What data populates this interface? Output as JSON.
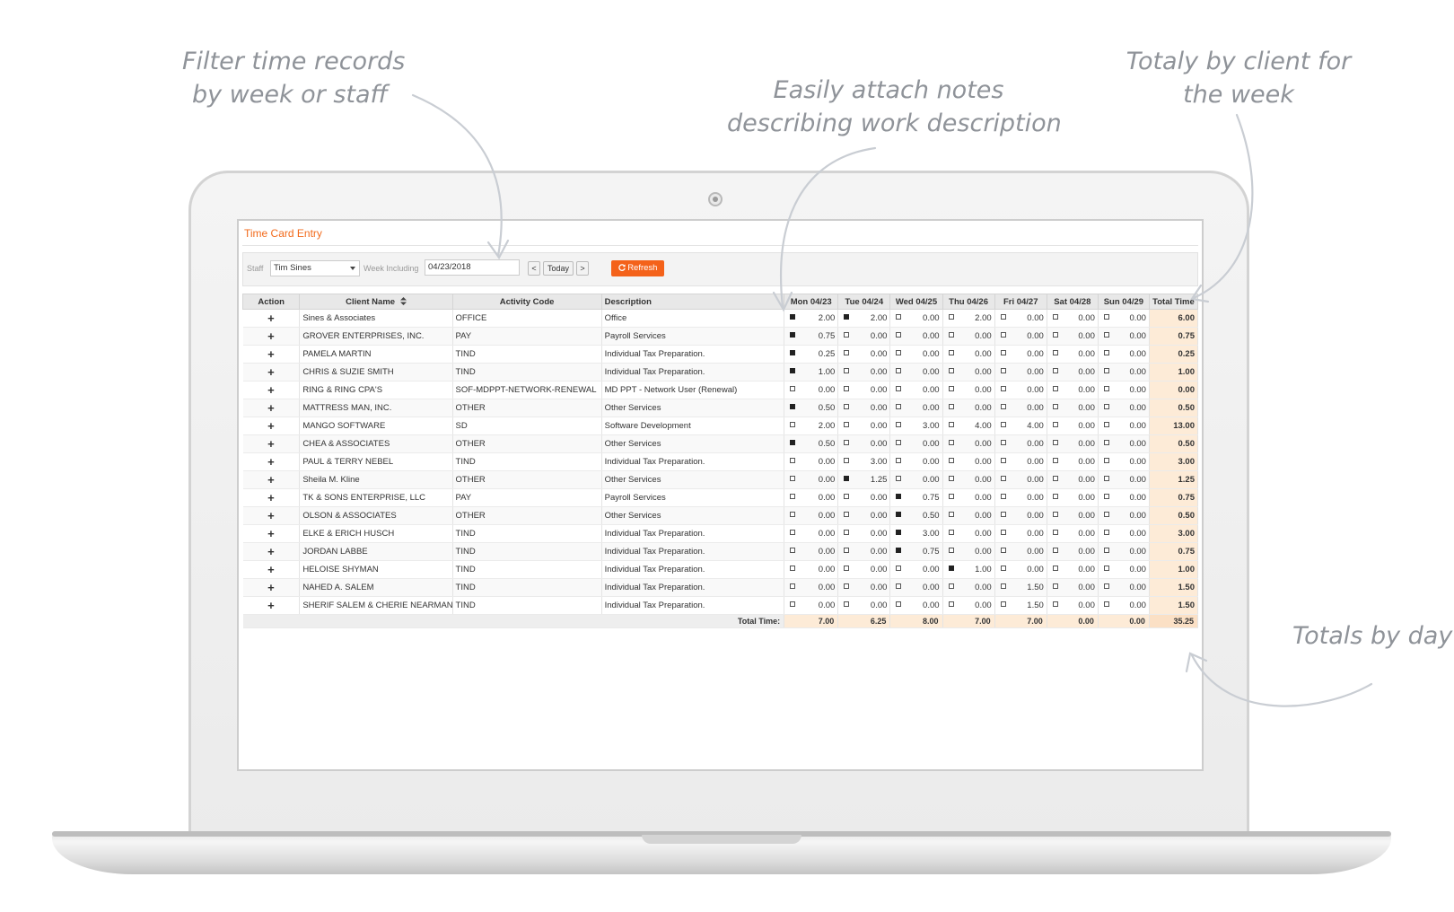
{
  "callouts": {
    "filter": [
      "Filter time records",
      "by week or staff"
    ],
    "notes": [
      "Easily attach notes",
      "describing work description"
    ],
    "client_totals": [
      "Totaly by client for",
      "the week"
    ],
    "day_totals": [
      "Totals by day"
    ]
  },
  "app": {
    "title": "Time Card Entry",
    "filters": {
      "staff_label": "Staff",
      "staff_value": "Tim Sines",
      "week_label": "Week Including",
      "week_value": "04/23/2018",
      "prev_label": "<",
      "today_label": "Today",
      "next_label": ">",
      "refresh_label": "Refresh",
      "refresh_icon": "refresh-icon"
    },
    "columns": [
      "Action",
      "Client Name",
      "Activity Code",
      "Description",
      "Mon 04/23",
      "Tue 04/24",
      "Wed 04/25",
      "Thu 04/26",
      "Fri 04/27",
      "Sat 04/28",
      "Sun 04/29",
      "Total Time"
    ],
    "action_label": "+",
    "sort_icon": "sort-icon",
    "rows": [
      {
        "client": "Sines & Associates",
        "code": "OFFICE",
        "desc": "Office",
        "days": [
          "2.00",
          "2.00",
          "0.00",
          "2.00",
          "0.00",
          "0.00",
          "0.00"
        ],
        "notes": [
          true,
          true,
          false,
          false,
          false,
          false,
          false
        ],
        "total": "6.00"
      },
      {
        "client": "GROVER ENTERPRISES, INC.",
        "code": "PAY",
        "desc": "Payroll Services",
        "days": [
          "0.75",
          "0.00",
          "0.00",
          "0.00",
          "0.00",
          "0.00",
          "0.00"
        ],
        "notes": [
          true,
          false,
          false,
          false,
          false,
          false,
          false
        ],
        "total": "0.75"
      },
      {
        "client": "PAMELA MARTIN",
        "code": "TIND",
        "desc": "Individual Tax Preparation.",
        "days": [
          "0.25",
          "0.00",
          "0.00",
          "0.00",
          "0.00",
          "0.00",
          "0.00"
        ],
        "notes": [
          true,
          false,
          false,
          false,
          false,
          false,
          false
        ],
        "total": "0.25"
      },
      {
        "client": "CHRIS & SUZIE SMITH",
        "code": "TIND",
        "desc": "Individual Tax Preparation.",
        "days": [
          "1.00",
          "0.00",
          "0.00",
          "0.00",
          "0.00",
          "0.00",
          "0.00"
        ],
        "notes": [
          true,
          false,
          false,
          false,
          false,
          false,
          false
        ],
        "total": "1.00"
      },
      {
        "client": "RING & RING CPA'S",
        "code": "SOF-MDPPT-NETWORK-RENEWAL",
        "desc": "MD PPT - Network User (Renewal)",
        "days": [
          "0.00",
          "0.00",
          "0.00",
          "0.00",
          "0.00",
          "0.00",
          "0.00"
        ],
        "notes": [
          false,
          false,
          false,
          false,
          false,
          false,
          false
        ],
        "total": "0.00"
      },
      {
        "client": "MATTRESS MAN, INC.",
        "code": "OTHER",
        "desc": "Other Services",
        "days": [
          "0.50",
          "0.00",
          "0.00",
          "0.00",
          "0.00",
          "0.00",
          "0.00"
        ],
        "notes": [
          true,
          false,
          false,
          false,
          false,
          false,
          false
        ],
        "total": "0.50"
      },
      {
        "client": "MANGO SOFTWARE",
        "code": "SD",
        "desc": "Software Development",
        "days": [
          "2.00",
          "0.00",
          "3.00",
          "4.00",
          "4.00",
          "0.00",
          "0.00"
        ],
        "notes": [
          false,
          false,
          false,
          false,
          false,
          false,
          false
        ],
        "total": "13.00"
      },
      {
        "client": "CHEA & ASSOCIATES",
        "code": "OTHER",
        "desc": "Other Services",
        "days": [
          "0.50",
          "0.00",
          "0.00",
          "0.00",
          "0.00",
          "0.00",
          "0.00"
        ],
        "notes": [
          true,
          false,
          false,
          false,
          false,
          false,
          false
        ],
        "total": "0.50"
      },
      {
        "client": "PAUL & TERRY NEBEL",
        "code": "TIND",
        "desc": "Individual Tax Preparation.",
        "days": [
          "0.00",
          "3.00",
          "0.00",
          "0.00",
          "0.00",
          "0.00",
          "0.00"
        ],
        "notes": [
          false,
          false,
          false,
          false,
          false,
          false,
          false
        ],
        "total": "3.00"
      },
      {
        "client": "Sheila M. Kline",
        "code": "OTHER",
        "desc": "Other Services",
        "days": [
          "0.00",
          "1.25",
          "0.00",
          "0.00",
          "0.00",
          "0.00",
          "0.00"
        ],
        "notes": [
          false,
          true,
          false,
          false,
          false,
          false,
          false
        ],
        "total": "1.25"
      },
      {
        "client": "TK & SONS ENTERPRISE, LLC",
        "code": "PAY",
        "desc": "Payroll Services",
        "days": [
          "0.00",
          "0.00",
          "0.75",
          "0.00",
          "0.00",
          "0.00",
          "0.00"
        ],
        "notes": [
          false,
          false,
          true,
          false,
          false,
          false,
          false
        ],
        "total": "0.75"
      },
      {
        "client": "OLSON & ASSOCIATES",
        "code": "OTHER",
        "desc": "Other Services",
        "days": [
          "0.00",
          "0.00",
          "0.50",
          "0.00",
          "0.00",
          "0.00",
          "0.00"
        ],
        "notes": [
          false,
          false,
          true,
          false,
          false,
          false,
          false
        ],
        "total": "0.50"
      },
      {
        "client": "ELKE & ERICH HUSCH",
        "code": "TIND",
        "desc": "Individual Tax Preparation.",
        "days": [
          "0.00",
          "0.00",
          "3.00",
          "0.00",
          "0.00",
          "0.00",
          "0.00"
        ],
        "notes": [
          false,
          false,
          true,
          false,
          false,
          false,
          false
        ],
        "total": "3.00"
      },
      {
        "client": "JORDAN LABBE",
        "code": "TIND",
        "desc": "Individual Tax Preparation.",
        "days": [
          "0.00",
          "0.00",
          "0.75",
          "0.00",
          "0.00",
          "0.00",
          "0.00"
        ],
        "notes": [
          false,
          false,
          true,
          false,
          false,
          false,
          false
        ],
        "total": "0.75"
      },
      {
        "client": "HELOISE SHYMAN",
        "code": "TIND",
        "desc": "Individual Tax Preparation.",
        "days": [
          "0.00",
          "0.00",
          "0.00",
          "1.00",
          "0.00",
          "0.00",
          "0.00"
        ],
        "notes": [
          false,
          false,
          false,
          true,
          false,
          false,
          false
        ],
        "total": "1.00"
      },
      {
        "client": "NAHED A. SALEM",
        "code": "TIND",
        "desc": "Individual Tax Preparation.",
        "days": [
          "0.00",
          "0.00",
          "0.00",
          "0.00",
          "1.50",
          "0.00",
          "0.00"
        ],
        "notes": [
          false,
          false,
          false,
          false,
          false,
          false,
          false
        ],
        "total": "1.50"
      },
      {
        "client": "SHERIF SALEM & CHERIE NEARMAN",
        "code": "TIND",
        "desc": "Individual Tax Preparation.",
        "days": [
          "0.00",
          "0.00",
          "0.00",
          "0.00",
          "1.50",
          "0.00",
          "0.00"
        ],
        "notes": [
          false,
          false,
          false,
          false,
          false,
          false,
          false
        ],
        "total": "1.50"
      }
    ],
    "total_row": {
      "label": "Total Time:",
      "days": [
        "7.00",
        "6.25",
        "8.00",
        "7.00",
        "7.00",
        "0.00",
        "0.00"
      ],
      "total": "35.25"
    }
  }
}
